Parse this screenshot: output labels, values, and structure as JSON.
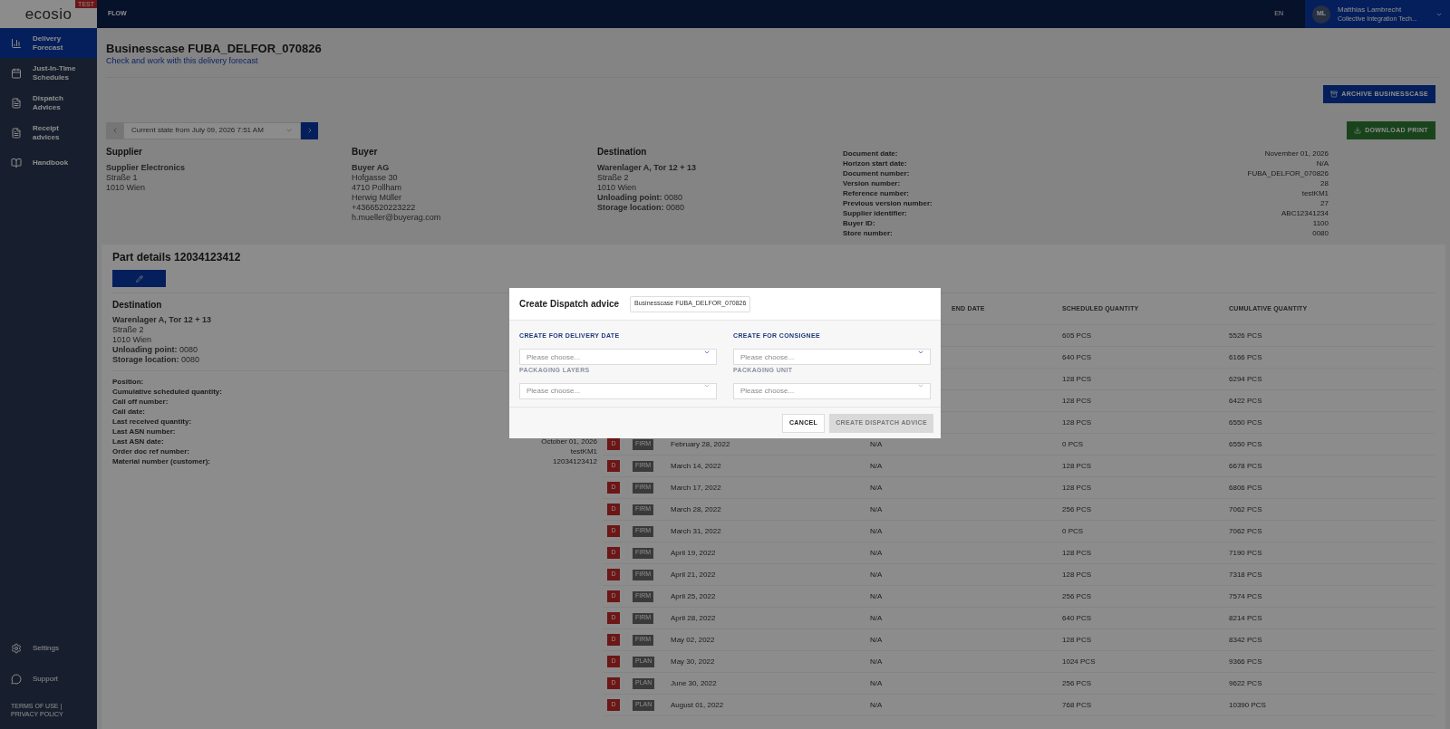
{
  "app": {
    "logo": "ecosio",
    "env_badge": "TEST",
    "nav_title": "FLOW",
    "language": "EN",
    "user": {
      "initials": "ML",
      "name": "Matthias Lambrecht",
      "org": "Collective Integration Tech..."
    }
  },
  "sidebar": {
    "items": [
      {
        "label": "Delivery Forecast",
        "selected": true
      },
      {
        "label": "Just-In-Time Schedules",
        "selected": false
      },
      {
        "label": "Dispatch Advices",
        "selected": false
      },
      {
        "label": "Receipt advices",
        "selected": false
      },
      {
        "label": "Handbook",
        "selected": false
      }
    ],
    "bottom_items": [
      {
        "label": "Settings"
      },
      {
        "label": "Support"
      }
    ],
    "footer": "TERMS OF USE | PRIVACY POLICY"
  },
  "page": {
    "title": "Businesscase FUBA_DELFOR_070826",
    "subtitle": "Check and work with this delivery forecast",
    "archive_button": "ARCHIVE BUSINESSCASE",
    "state_select": "Current state from July 09, 2026 7:51 AM",
    "download_button": "DOWNLOAD PRINT"
  },
  "parties": [
    {
      "heading": "Supplier",
      "lines": [
        {
          "text": "Supplier Electronics",
          "bold": true
        },
        {
          "text": "Straße 1",
          "bold": false
        },
        {
          "text": "1010 Wien",
          "bold": false
        }
      ]
    },
    {
      "heading": "Buyer",
      "lines": [
        {
          "text": "Buyer AG",
          "bold": true
        },
        {
          "text": "Hofgasse 30",
          "bold": false
        },
        {
          "text": "4710 Pollham",
          "bold": false
        },
        {
          "text": "Herwig Müller",
          "bold": false
        },
        {
          "text": "+4366520223222",
          "bold": false
        },
        {
          "text": "h.mueller@buyerag.com",
          "bold": false
        }
      ]
    },
    {
      "heading": "Destination",
      "lines": [
        {
          "text": "Warenlager A, Tor 12 + 13",
          "bold": true
        },
        {
          "text": "Straße 2",
          "bold": false
        },
        {
          "text": "1010 Wien",
          "bold": false
        },
        {
          "text": "**Unloading point:** 0080",
          "bold": false
        },
        {
          "text": "**Storage location:** 0080",
          "bold": false
        }
      ]
    }
  ],
  "document_info": [
    {
      "label": "Document date:",
      "value": "November 01, 2026"
    },
    {
      "label": "Horizon start date:",
      "value": "N/A"
    },
    {
      "label": "Document number:",
      "value": "FUBA_DELFOR_070826"
    },
    {
      "label": "Version number:",
      "value": "28"
    },
    {
      "label": "Reference number:",
      "value": "testKM1"
    },
    {
      "label": "Previous version number:",
      "value": "27"
    },
    {
      "label": "Supplier identifier:",
      "value": "ABC12341234"
    },
    {
      "label": "Buyer ID:",
      "value": "1100"
    },
    {
      "label": "Store number:",
      "value": "0080"
    }
  ],
  "part_details": {
    "title": "Part details 12034123412",
    "destination": {
      "heading": "Destination",
      "lines": [
        {
          "text": "Warenlager A, Tor 12 + 13",
          "bold": true
        },
        {
          "text": "Straße 2",
          "bold": false
        },
        {
          "text": "1010 Wien",
          "bold": false
        },
        {
          "text": "**Unloading point:** 0080",
          "bold": false
        },
        {
          "text": "**Storage location:** 0080",
          "bold": false
        }
      ]
    },
    "fields": [
      {
        "label": "Position:"
      },
      {
        "label": "Cumulative scheduled quantity:"
      },
      {
        "label": "Call off number:"
      },
      {
        "label": "Call date:"
      },
      {
        "label": "Last received quantity:"
      },
      {
        "label": "Last ASN number:"
      },
      {
        "label": "Last ASN date:",
        "value": "October 01, 2026"
      },
      {
        "label": "Order doc ref number:",
        "value": "testKM1"
      },
      {
        "label": "Material number (customer):",
        "value": "12034123412"
      }
    ]
  },
  "table": {
    "columns": [
      "END DATE",
      "SCHEDULED QUANTITY",
      "CUMULATIVE QUANTITY"
    ],
    "rows": [
      {
        "scheduled": "605 PCS",
        "cumulative": "5526 PCS"
      },
      {
        "scheduled": "640 PCS",
        "cumulative": "6166 PCS"
      },
      {
        "scheduled": "128 PCS",
        "cumulative": "6294 PCS"
      },
      {
        "scheduled": "128 PCS",
        "cumulative": "6422 PCS"
      },
      {
        "scheduled": "128 PCS",
        "cumulative": "6550 PCS"
      },
      {
        "badge": "D",
        "tag": "FIRM",
        "date": "February 28, 2022",
        "end_date": "N/A",
        "scheduled": "0 PCS",
        "cumulative": "6550 PCS"
      },
      {
        "badge": "D",
        "tag": "FIRM",
        "date": "March 14, 2022",
        "end_date": "N/A",
        "scheduled": "128 PCS",
        "cumulative": "6678 PCS"
      },
      {
        "badge": "D",
        "tag": "FIRM",
        "date": "March 17, 2022",
        "end_date": "N/A",
        "scheduled": "128 PCS",
        "cumulative": "6806 PCS"
      },
      {
        "badge": "D",
        "tag": "FIRM",
        "date": "March 28, 2022",
        "end_date": "N/A",
        "scheduled": "256 PCS",
        "cumulative": "7062 PCS"
      },
      {
        "badge": "D",
        "tag": "FIRM",
        "date": "March 31, 2022",
        "end_date": "N/A",
        "scheduled": "0 PCS",
        "cumulative": "7062 PCS"
      },
      {
        "badge": "D",
        "tag": "FIRM",
        "date": "April 19, 2022",
        "end_date": "N/A",
        "scheduled": "128 PCS",
        "cumulative": "7190 PCS"
      },
      {
        "badge": "D",
        "tag": "FIRM",
        "date": "April 21, 2022",
        "end_date": "N/A",
        "scheduled": "128 PCS",
        "cumulative": "7318 PCS"
      },
      {
        "badge": "D",
        "tag": "FIRM",
        "date": "April 25, 2022",
        "end_date": "N/A",
        "scheduled": "256 PCS",
        "cumulative": "7574 PCS"
      },
      {
        "badge": "D",
        "tag": "FIRM",
        "date": "April 28, 2022",
        "end_date": "N/A",
        "scheduled": "640 PCS",
        "cumulative": "8214 PCS"
      },
      {
        "badge": "D",
        "tag": "FIRM",
        "date": "May 02, 2022",
        "end_date": "N/A",
        "scheduled": "128 PCS",
        "cumulative": "8342 PCS"
      },
      {
        "badge": "D",
        "tag": "PLAN",
        "date": "May 30, 2022",
        "end_date": "N/A",
        "scheduled": "1024 PCS",
        "cumulative": "9366 PCS"
      },
      {
        "badge": "D",
        "tag": "PLAN",
        "date": "June 30, 2022",
        "end_date": "N/A",
        "scheduled": "256 PCS",
        "cumulative": "9622 PCS"
      },
      {
        "badge": "D",
        "tag": "PLAN",
        "date": "August 01, 2022",
        "end_date": "N/A",
        "scheduled": "768 PCS",
        "cumulative": "10390 PCS"
      }
    ]
  },
  "modal": {
    "title": "Create Dispatch advice",
    "reference": "Businesscase FUBA_DELFOR_070826",
    "fields": [
      {
        "label": "CREATE FOR DELIVERY DATE",
        "placeholder": "Please choose...",
        "disabled": false
      },
      {
        "label": "CREATE FOR CONSIGNEE",
        "placeholder": "Please choose...",
        "disabled": false
      },
      {
        "label": "PACKAGING LAYERS",
        "placeholder": "Please choose...",
        "disabled": true
      },
      {
        "label": "PACKAGING UNIT",
        "placeholder": "Please choose...",
        "disabled": true
      }
    ],
    "cancel": "CANCEL",
    "submit": {
      "label": "CREATE DISPATCH ADVICE",
      "disabled": true
    }
  }
}
